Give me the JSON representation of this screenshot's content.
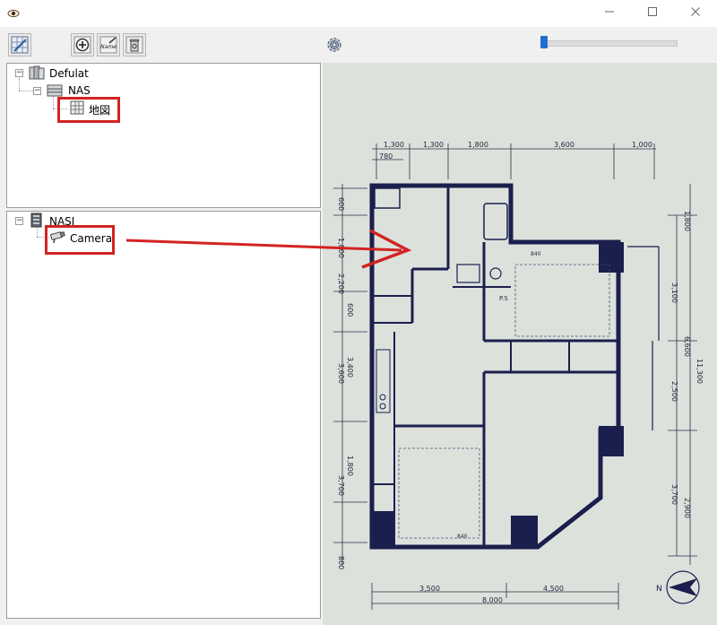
{
  "tree_top": {
    "root_label": "Defulat",
    "child_label": "NAS",
    "leaf_label": "地図"
  },
  "tree_bottom": {
    "root_label": "NASI",
    "leaf_label": "Camera"
  },
  "toolbar": {
    "name_icon_text": "Name"
  },
  "floorplan": {
    "top_dims": [
      "1,300",
      "1,300",
      "1,800",
      "3,600",
      "1,000"
    ],
    "top_dim_small": "780",
    "left_dims": [
      "600",
      "1,800",
      "2,200",
      "600",
      "3,400",
      "3,600",
      "1,800",
      "3,700",
      "800"
    ],
    "right_inner_dims": [
      "1,800",
      "3,100",
      "2,500",
      "3,700"
    ],
    "right_outer_dims": [
      "6,600",
      "11,300",
      "2,900"
    ],
    "bottom_dims": [
      "3,500",
      "4,500"
    ],
    "bottom_total": "8,000",
    "room_labels": [
      "840",
      "840",
      "P.S"
    ],
    "compass_label": "N"
  },
  "colors": {
    "highlight": "#d22323",
    "wall": "#1b1f4d",
    "paper": "#dde1dc"
  }
}
